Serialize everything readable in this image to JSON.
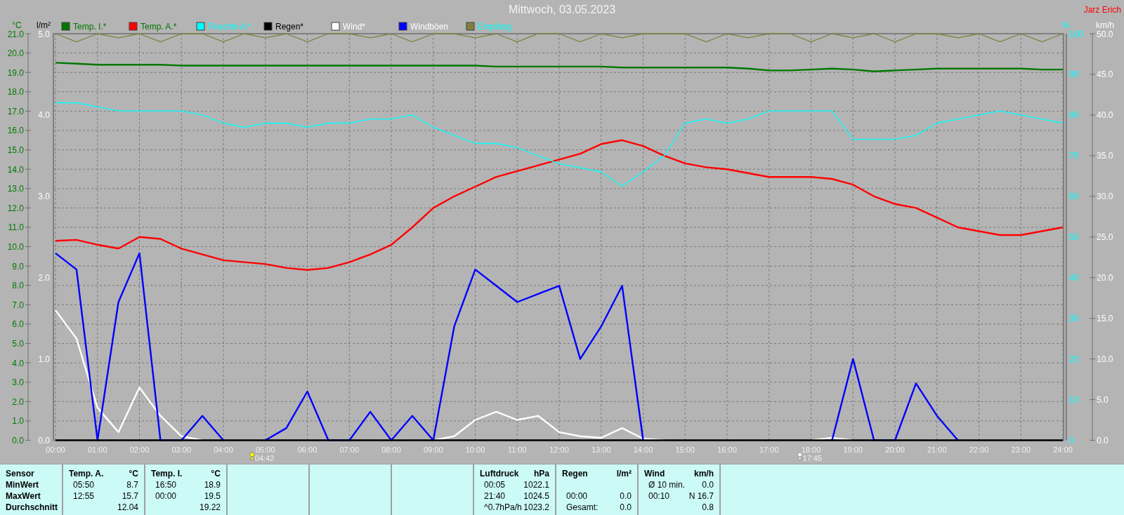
{
  "title": "Mittwoch, 03.05.2023",
  "author": "Jarz Erich",
  "rain_scale": {
    "label": "l/m²",
    "ticks": [
      "5.0",
      "4.0",
      "3.0",
      "2.0",
      "1.0",
      "0.0"
    ]
  },
  "chart_data": {
    "type": "line",
    "grid": true,
    "legend": "top",
    "xlim": [
      0,
      24
    ],
    "x": [
      0,
      0.5,
      1,
      1.5,
      2,
      2.5,
      3,
      3.5,
      4,
      4.5,
      5,
      5.5,
      6,
      6.5,
      7,
      7.5,
      8,
      8.5,
      9,
      9.5,
      10,
      10.5,
      11,
      11.5,
      12,
      12.5,
      13,
      13.5,
      14,
      14.5,
      15,
      15.5,
      16,
      16.5,
      17,
      17.5,
      18,
      18.5,
      19,
      19.5,
      20,
      20.5,
      21,
      21.5,
      22,
      22.5,
      23,
      23.5,
      24
    ],
    "xticks": [
      {
        "value": 0,
        "label": "00:00"
      },
      {
        "value": 1,
        "label": "01:00"
      },
      {
        "value": 2,
        "label": "02:00"
      },
      {
        "value": 3,
        "label": "03:00"
      },
      {
        "value": 4,
        "label": "04:00"
      },
      {
        "value": 5,
        "label": "05:00"
      },
      {
        "value": 6,
        "label": "06:00"
      },
      {
        "value": 7,
        "label": "07:00"
      },
      {
        "value": 8,
        "label": "08:00"
      },
      {
        "value": 9,
        "label": "09:00"
      },
      {
        "value": 10,
        "label": "10:00"
      },
      {
        "value": 11,
        "label": "11:00"
      },
      {
        "value": 12,
        "label": "12:00"
      },
      {
        "value": 13,
        "label": "13:00"
      },
      {
        "value": 14,
        "label": "14:00"
      },
      {
        "value": 15,
        "label": "15:00"
      },
      {
        "value": 16,
        "label": "16:00"
      },
      {
        "value": 17,
        "label": "17:00"
      },
      {
        "value": 18,
        "label": "18:00"
      },
      {
        "value": 19,
        "label": "19:00"
      },
      {
        "value": 20,
        "label": "20:00"
      },
      {
        "value": 21,
        "label": "21:00"
      },
      {
        "value": 22,
        "label": "22:00"
      },
      {
        "value": 23,
        "label": "23:00"
      },
      {
        "value": 24,
        "label": "24:00"
      }
    ],
    "ylabel": "°C",
    "ylim": [
      0,
      21
    ],
    "yticks": [
      {
        "value": 0,
        "label": "0.0"
      },
      {
        "value": 1,
        "label": "1.0"
      },
      {
        "value": 2,
        "label": "2.0"
      },
      {
        "value": 3,
        "label": "3.0"
      },
      {
        "value": 4,
        "label": "4.0"
      },
      {
        "value": 5,
        "label": "5.0"
      },
      {
        "value": 6,
        "label": "6.0"
      },
      {
        "value": 7,
        "label": "7.0"
      },
      {
        "value": 8,
        "label": "8.0"
      },
      {
        "value": 9,
        "label": "9.0"
      },
      {
        "value": 10,
        "label": "10.0"
      },
      {
        "value": 11,
        "label": "11.0"
      },
      {
        "value": 12,
        "label": "12.0"
      },
      {
        "value": 13,
        "label": "13.0"
      },
      {
        "value": 14,
        "label": "14.0"
      },
      {
        "value": 15,
        "label": "15.0"
      },
      {
        "value": 16,
        "label": "16.0"
      },
      {
        "value": 17,
        "label": "17.0"
      },
      {
        "value": 18,
        "label": "18.0"
      },
      {
        "value": 19,
        "label": "19.0"
      },
      {
        "value": 20,
        "label": "20.0"
      },
      {
        "value": 21,
        "label": "21.0"
      }
    ],
    "y2label": "%",
    "y2lim": [
      0,
      100
    ],
    "y2ticks": [
      {
        "value": 0,
        "label": "0"
      },
      {
        "value": 10,
        "label": "10"
      },
      {
        "value": 20,
        "label": "20"
      },
      {
        "value": 30,
        "label": "30"
      },
      {
        "value": 40,
        "label": "40"
      },
      {
        "value": 50,
        "label": "50"
      },
      {
        "value": 60,
        "label": "60"
      },
      {
        "value": 70,
        "label": "70"
      },
      {
        "value": 80,
        "label": "80"
      },
      {
        "value": 90,
        "label": "90"
      },
      {
        "value": 100,
        "label": "100"
      }
    ],
    "y3label": "km/h",
    "y3lim": [
      0,
      50
    ],
    "y3ticks": [
      {
        "value": 0,
        "label": "0.0"
      },
      {
        "value": 5,
        "label": "5.0"
      },
      {
        "value": 10,
        "label": "10.0"
      },
      {
        "value": 15,
        "label": "15.0"
      },
      {
        "value": 20,
        "label": "20.0"
      },
      {
        "value": 25,
        "label": "25.0"
      },
      {
        "value": 30,
        "label": "30.0"
      },
      {
        "value": 35,
        "label": "35.0"
      },
      {
        "value": 40,
        "label": "40.0"
      },
      {
        "value": 45,
        "label": "45.0"
      },
      {
        "value": 50,
        "label": "50.0"
      }
    ],
    "series": [
      {
        "name": "Temp. I.*",
        "color": "#007800",
        "values": [
          19.5,
          19.45,
          19.4,
          19.4,
          19.4,
          19.4,
          19.35,
          19.35,
          19.35,
          19.35,
          19.35,
          19.35,
          19.35,
          19.35,
          19.35,
          19.35,
          19.35,
          19.35,
          19.35,
          19.35,
          19.35,
          19.3,
          19.3,
          19.3,
          19.3,
          19.3,
          19.3,
          19.25,
          19.25,
          19.25,
          19.25,
          19.25,
          19.25,
          19.2,
          19.1,
          19.1,
          19.15,
          19.2,
          19.15,
          19.05,
          19.1,
          19.15,
          19.2,
          19.2,
          19.2,
          19.2,
          19.2,
          19.15,
          19.15
        ]
      },
      {
        "name": "Temp. A.*",
        "color": "#ff0000",
        "values": [
          10.3,
          10.35,
          10.1,
          9.9,
          10.5,
          10.4,
          9.9,
          9.6,
          9.3,
          9.2,
          9.1,
          8.9,
          8.8,
          8.9,
          9.2,
          9.6,
          10.1,
          11.0,
          12.0,
          12.6,
          13.1,
          13.6,
          13.9,
          14.2,
          14.5,
          14.8,
          15.3,
          15.5,
          15.2,
          14.7,
          14.3,
          14.1,
          14.0,
          13.8,
          13.6,
          13.6,
          13.6,
          13.5,
          13.2,
          12.6,
          12.2,
          12.0,
          11.5,
          11.0,
          10.8,
          10.6,
          10.6,
          10.8,
          11.0
        ]
      },
      {
        "name": "Feuchte A.*",
        "color": "#00ffff",
        "axis": "y2",
        "values": [
          83,
          83,
          82,
          81,
          81,
          81,
          81,
          80,
          78,
          77,
          78,
          78,
          77,
          78,
          78,
          79,
          79,
          80,
          77,
          75,
          73,
          73,
          72,
          70,
          68,
          67,
          66,
          62.5,
          66,
          70,
          78,
          79,
          78,
          79,
          81,
          81,
          81,
          81,
          74,
          74,
          74,
          75,
          78,
          79,
          80,
          81,
          80,
          79,
          78
        ]
      },
      {
        "name": "Regen*",
        "color": "#000000",
        "values": [
          0,
          0,
          0,
          0,
          0,
          0,
          0,
          0,
          0,
          0,
          0,
          0,
          0,
          0,
          0,
          0,
          0,
          0,
          0,
          0,
          0,
          0,
          0,
          0,
          0,
          0,
          0,
          0,
          0,
          0,
          0,
          0,
          0,
          0,
          0,
          0,
          0,
          0,
          0,
          0,
          0,
          0,
          0,
          0,
          0,
          0,
          0,
          0,
          0
        ]
      },
      {
        "name": "Wind*",
        "color": "#ffffff",
        "axis": "y3",
        "values": [
          16,
          12.5,
          4,
          1,
          6.5,
          3,
          0.5,
          0,
          null,
          null,
          null,
          null,
          null,
          null,
          null,
          null,
          null,
          null,
          0,
          0.5,
          2.5,
          3.5,
          2.5,
          3,
          1,
          0.5,
          0.3,
          1.5,
          0.2,
          0,
          null,
          null,
          null,
          null,
          null,
          null,
          0,
          0.3,
          0,
          null,
          null,
          null,
          null,
          null,
          null,
          null,
          null,
          null,
          null
        ]
      },
      {
        "name": "Windböen",
        "color": "#0000ff",
        "axis": "y3",
        "values": [
          23,
          21,
          0,
          17,
          23,
          0,
          0,
          3,
          0,
          null,
          0,
          1.5,
          6,
          0,
          0,
          3.5,
          0,
          3,
          0,
          14,
          21,
          19,
          17,
          18,
          19,
          10,
          14,
          19,
          0,
          null,
          null,
          null,
          null,
          null,
          null,
          null,
          null,
          0,
          10,
          0,
          0,
          7,
          3,
          0,
          null,
          null,
          null,
          null,
          null
        ]
      },
      {
        "name": "Empfang",
        "color": "#808040",
        "axis": "y2",
        "values": [
          100,
          98,
          100,
          99,
          100,
          98,
          100,
          100,
          98,
          100,
          99,
          100,
          98,
          100,
          100,
          99,
          100,
          98,
          100,
          100,
          99,
          100,
          98,
          100,
          100,
          98,
          100,
          99,
          100,
          100,
          100,
          98,
          100,
          99,
          100,
          100,
          98,
          100,
          99,
          100,
          98,
          100,
          100,
          99,
          100,
          98,
          100,
          98,
          100
        ]
      }
    ]
  },
  "sun_marks": [
    {
      "kind": "sunrise",
      "time": "04:42"
    },
    {
      "kind": "sunset",
      "time": "17:45"
    }
  ],
  "stats": [
    {
      "kind": "labels",
      "title": "Sensor",
      "rows": [
        {
          "label": "MinWert"
        },
        {
          "label": "MaxWert"
        },
        {
          "label": "Durchschnitt"
        }
      ]
    },
    {
      "kind": "values",
      "title": "Temp. A.",
      "unit": "°C",
      "rows": [
        {
          "time": "05:50",
          "value": "8.7"
        },
        {
          "time": "12:55",
          "value": "15.7"
        },
        {
          "value": "12.04"
        }
      ]
    },
    {
      "kind": "values",
      "title": "Temp. I.",
      "unit": "°C",
      "rows": [
        {
          "time": "16:50",
          "value": "18.9"
        },
        {
          "time": "00:00",
          "value": "19.5"
        },
        {
          "value": "19.22"
        }
      ]
    },
    {
      "kind": "empty"
    },
    {
      "kind": "empty"
    },
    {
      "kind": "empty"
    },
    {
      "kind": "values",
      "title": "Luftdruck",
      "unit": "hPa",
      "rows": [
        {
          "time": "00:05",
          "value": "1022.1"
        },
        {
          "time": "21:40",
          "value": "1024.5"
        },
        {
          "time": "^0.7hPa/h",
          "value": "1023.2"
        }
      ]
    },
    {
      "kind": "values",
      "title": "Regen",
      "unit": "l/m²",
      "rows": [
        {},
        {
          "time": "00:00",
          "value": "0.0"
        },
        {
          "time": "Gesamt:",
          "value": "0.0"
        }
      ]
    },
    {
      "kind": "values",
      "title": "Wind",
      "unit": "km/h",
      "rows": [
        {
          "time": "Ø 10 min.",
          "value": "0.0"
        },
        {
          "time": "00:10",
          "value": "N 16.7"
        },
        {
          "value": "0.8"
        }
      ]
    }
  ]
}
